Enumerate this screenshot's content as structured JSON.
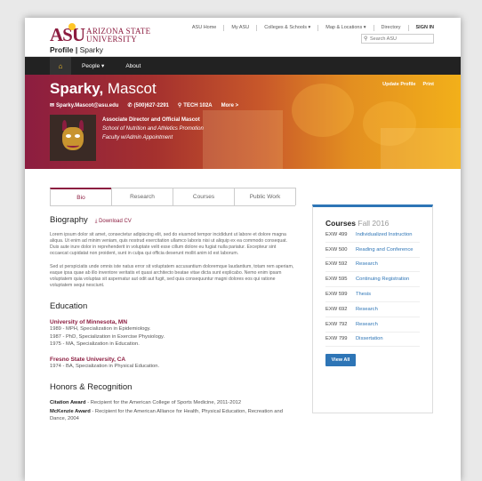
{
  "logo": {
    "mark": "ASU",
    "line1": "ARIZONA STATE",
    "line2": "UNIVERSITY"
  },
  "site_title": {
    "main": "Profile",
    "sub": "Sparky"
  },
  "top_links": [
    "ASU Home",
    "My ASU",
    "Colleges & Schools ▾",
    "Map & Locations ▾",
    "Directory",
    "SIGN IN"
  ],
  "search": {
    "placeholder": "Search ASU"
  },
  "nav": {
    "items": [
      "People ▾",
      "About"
    ]
  },
  "hero": {
    "first_name": "Sparky,",
    "last_name": " Mascot",
    "actions": [
      "Update Profile",
      "Print"
    ],
    "email": "Sparky.Mascot@asu.edu",
    "phone": "(500)627-2291",
    "location": "TECH 102A",
    "more": "More >",
    "title1": "Associate Director and Official Mascot",
    "title2": "School of Nutrition and Athletics Promotion",
    "title3": "Faculty w/Admin Appointment"
  },
  "tabs": [
    "Bio",
    "Research",
    "Courses",
    "Public Work"
  ],
  "biography": {
    "heading": "Biography",
    "download": "⤓ Download CV",
    "para1": "Lorem ipsum dolor sit amet, consectetur adipiscing elit, sed do eiusmod tempor incididunt ut labore et dolore magna aliqua. Ut enim ad minim veniam, quis nostrud exercitation ullamco laboris nisi ut aliquip ex ea commodo consequat. Duis aute irure dolor in reprehenderit in voluptate velit esse cillum dolore eu fugiat nulla pariatur. Excepteur sint occaecat cupidatat non proident, sunt in culpa qui officia deserunt mollit anim id est laborum.",
    "para2": "Sed ut perspiciatis unde omnis iste natus error sit voluptatem accusantium doloremque laudantium, totam rem aperiam, eaque ipsa quae ab illo inventore veritatis et quasi architecto beatae vitae dicta sunt explicabo. Nemo enim ipsam voluptatem quia voluptas sit aspernatur aut odit aut fugit, sed quia consequuntur magni dolores eos qui ratione voluptatem sequi nesciunt."
  },
  "education": {
    "heading": "Education",
    "school1": "University of Minnesota, MN",
    "school1_lines": [
      "1989 - MPH, Specialization in Epidemiology.",
      "1987 - PhD, Specialization in Exercise Physiology.",
      "1975 - MA, Specialization in Education."
    ],
    "school2": "Fresno State University, CA",
    "school2_lines": [
      "1974 - BA, Specialization in Physical Education."
    ]
  },
  "honors": {
    "heading": "Honors & Recognition",
    "items": [
      {
        "name": "Citation Award",
        "text": " - Recipient for the American College of Sports Medicine, 2011-2012"
      },
      {
        "name": "McKenzie Award",
        "text": " - Recipient for the American Alliance for Health, Physical Education, Recreation and Dance, 2004"
      }
    ]
  },
  "courses": {
    "title": "Courses",
    "term": " Fall 2016",
    "rows": [
      {
        "code": "EXW 499",
        "name": "Individualized Instruction"
      },
      {
        "code": "EXW 500",
        "name": "Reading and Conference"
      },
      {
        "code": "EXW 592",
        "name": "Research"
      },
      {
        "code": "EXW 595",
        "name": "Continuing Registration"
      },
      {
        "code": "EXW 599",
        "name": "Thesis"
      },
      {
        "code": "EXW 692",
        "name": "Research"
      },
      {
        "code": "EXW 792",
        "name": "Research"
      },
      {
        "code": "EXW 799",
        "name": "Dissertation"
      }
    ],
    "view_all": "View All"
  },
  "colors": {
    "maroon": "#8c1d40",
    "gold": "#ffc627",
    "blue": "#2e75b6"
  }
}
